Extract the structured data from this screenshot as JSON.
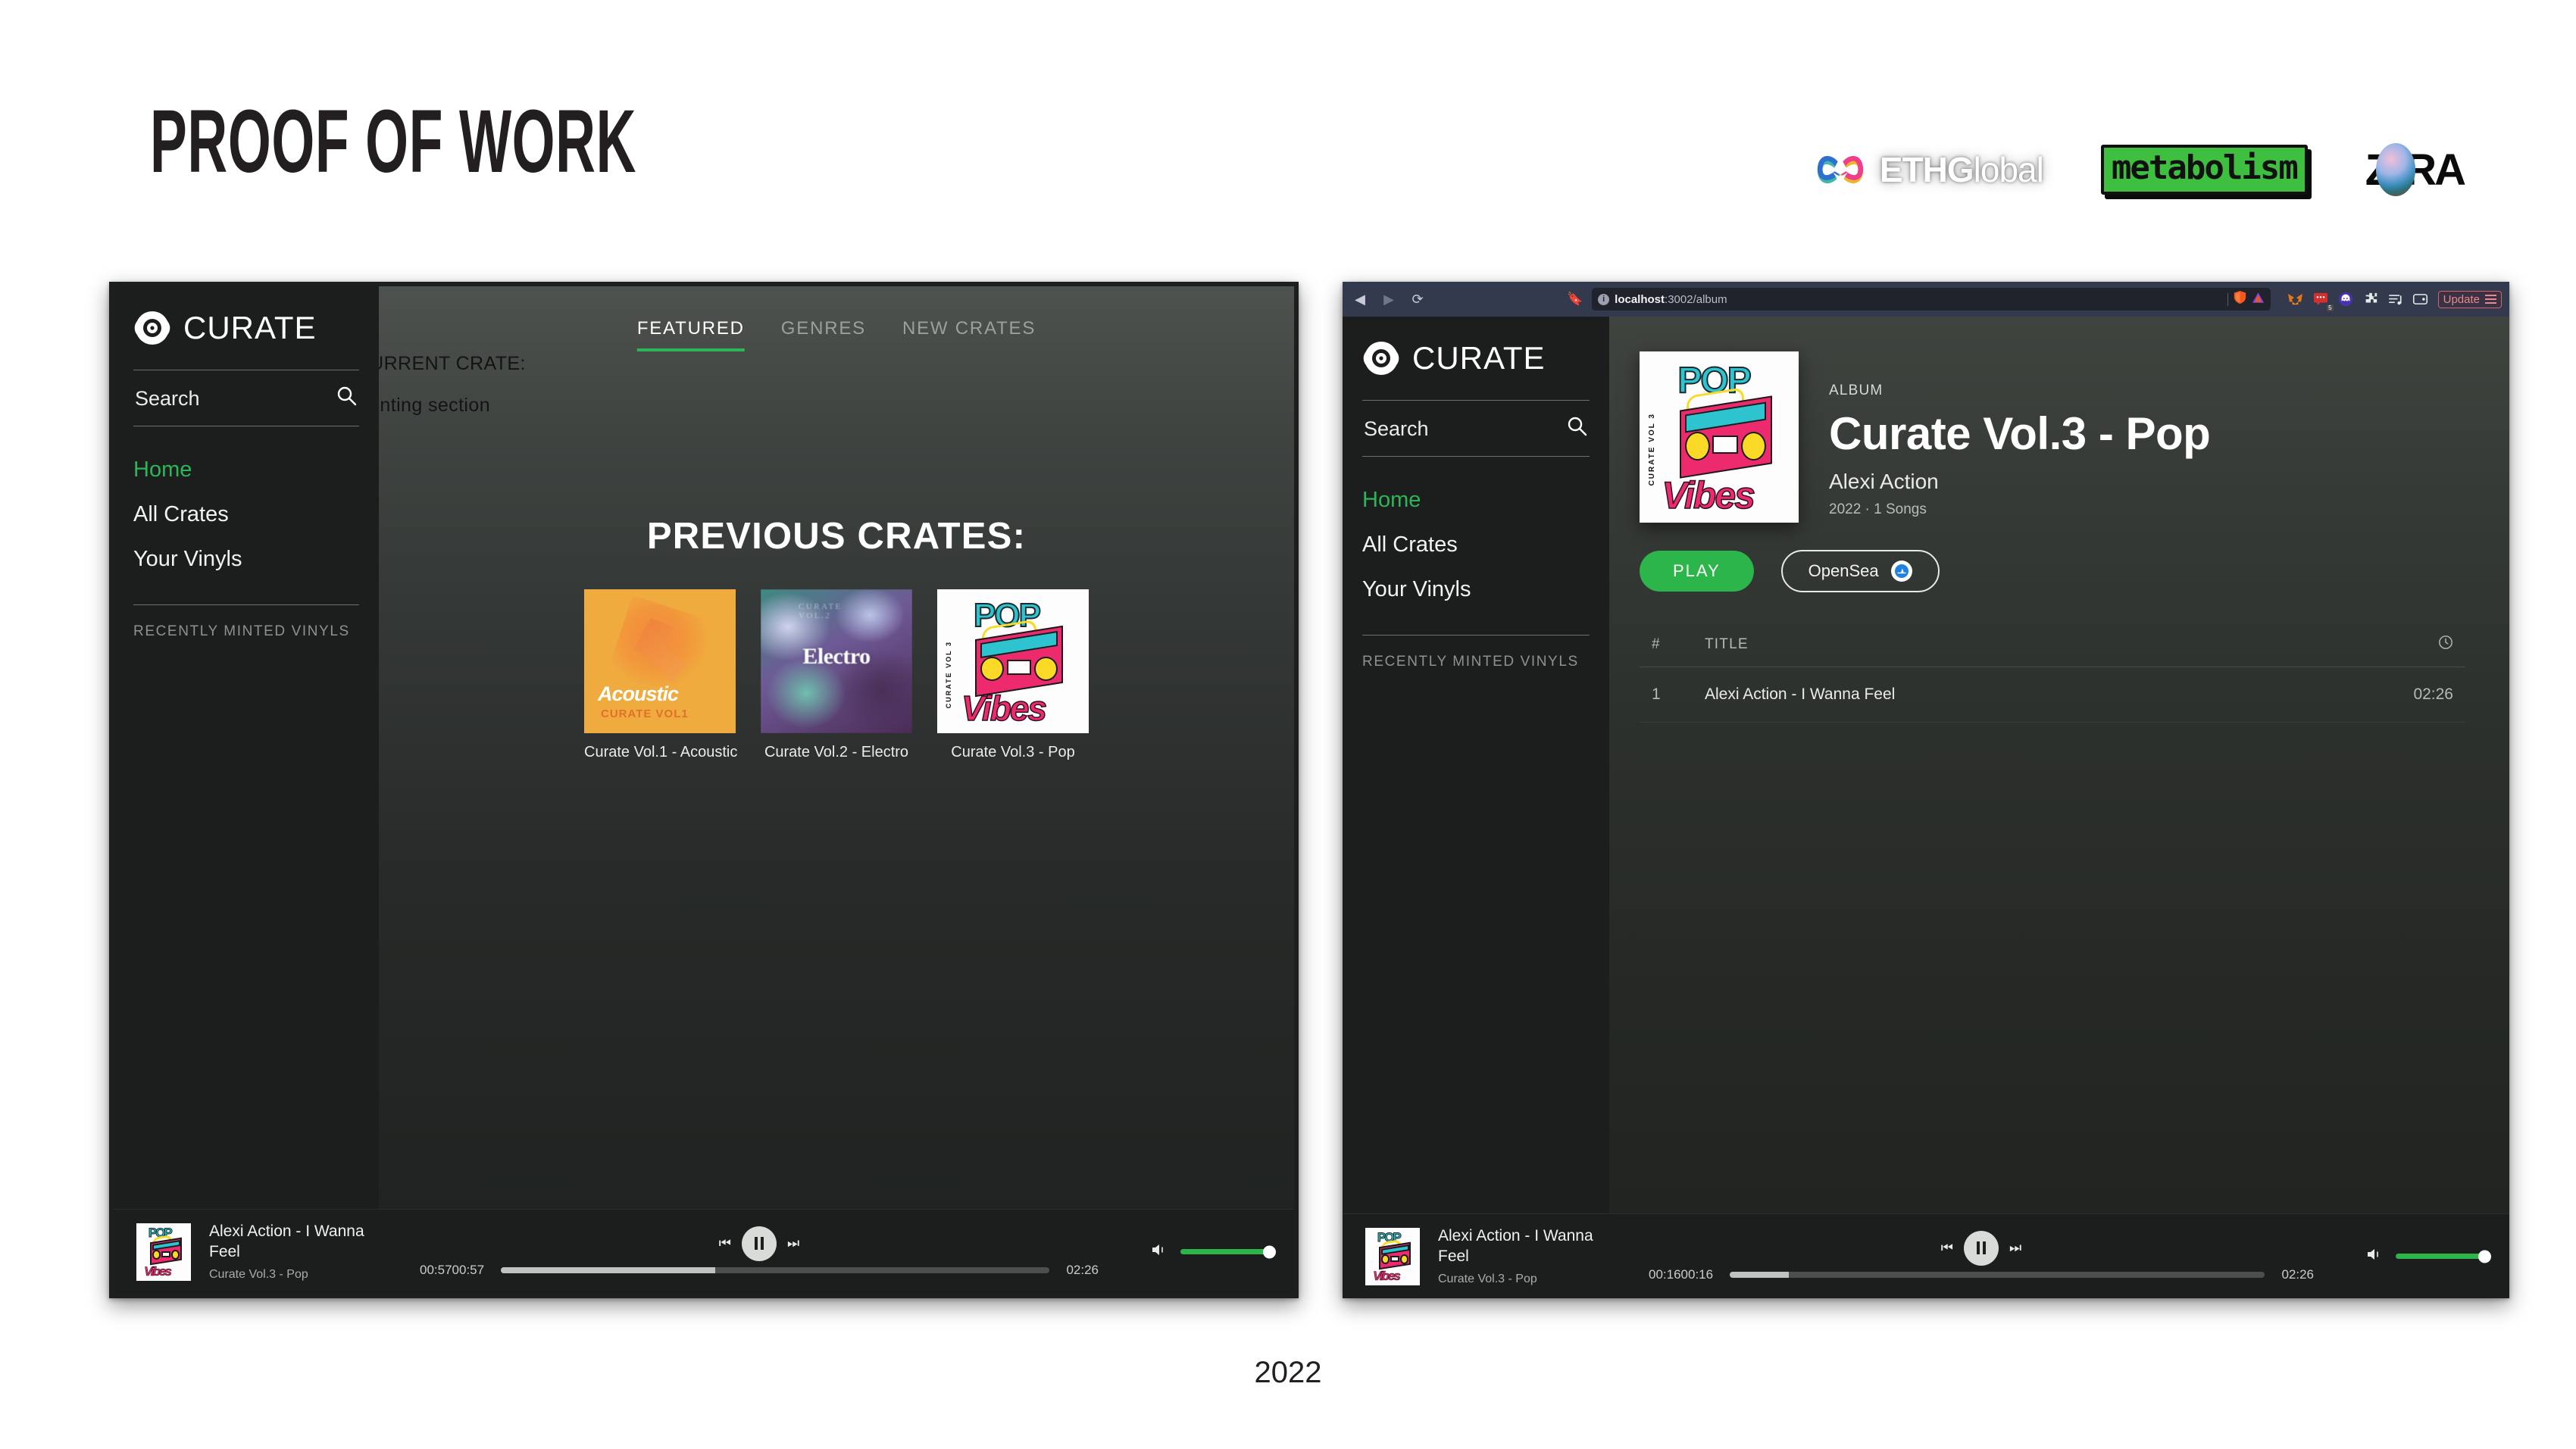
{
  "slide": {
    "title": "PROOF OF WORK",
    "caption": "2022",
    "logos": [
      {
        "name": "ETHGlobal",
        "part1": "ETHG",
        "part2": "lobal"
      },
      {
        "name": "metabolism",
        "text": "metabolism"
      },
      {
        "name": "ZORA",
        "left": "Z",
        "right": "RA"
      }
    ]
  },
  "sidebar": {
    "brand": "CURATE",
    "search_label": "Search",
    "items": [
      {
        "label": "Home",
        "active": true
      },
      {
        "label": "All Crates",
        "active": false
      },
      {
        "label": "Your Vinyls",
        "active": false
      }
    ],
    "section_caption": "RECENTLY MINTED VINYLS"
  },
  "left_window": {
    "tabs": [
      {
        "label": "FEATURED",
        "active": true
      },
      {
        "label": "GENRES",
        "active": false
      },
      {
        "label": "NEW CRATES",
        "active": false
      }
    ],
    "mint_heading": "MINT THE CURRENT CRATE:",
    "mint_note": "working on minting section",
    "previous_crates_heading": "PREVIOUS CRATES:",
    "crates": [
      {
        "label": "Curate Vol.1 - Acoustic",
        "art": "acoustic",
        "art_title": "Acoustic",
        "art_sub": "CURATE VOL1"
      },
      {
        "label": "Curate Vol.2 - Electro",
        "art": "electro",
        "art_title": "Electro",
        "art_sub": "CURATE VOL.2"
      },
      {
        "label": "Curate Vol.3 - Pop",
        "art": "pop",
        "art_title": "POP",
        "art_sub": "Vibes",
        "art_side": "CURATE VOL 3"
      }
    ],
    "player": {
      "track": "Alexi Action - I Wanna Feel",
      "album": "Curate Vol.3 - Pop",
      "elapsed": "00:5700:57",
      "duration": "02:26",
      "progress_percent": 39,
      "volume_percent": 100
    }
  },
  "right_window": {
    "browser": {
      "back_icon": "back-arrow-icon",
      "forward_icon": "forward-arrow-icon",
      "reload_icon": "reload-icon",
      "bookmark_icon": "bookmark-icon",
      "url_host": "localhost",
      "url_path": ":3002/album",
      "update_label": "Update",
      "extensions": [
        "metamask-fox-icon",
        "notification-badge-icon",
        "phantom-ghost-icon",
        "puzzle-piece-icon",
        "playlist-icon",
        "wallet-icon"
      ],
      "badge_count": "5"
    },
    "album": {
      "kicker": "ALBUM",
      "title": "Curate Vol.3 - Pop",
      "artist": "Alexi Action",
      "sub": "2022 · 1 Songs",
      "play_label": "PLAY",
      "opensea_label": "OpenSea"
    },
    "tracklist": {
      "headers": {
        "num": "#",
        "title": "TITLE",
        "duration_icon": "clock-icon"
      },
      "rows": [
        {
          "num": "1",
          "title": "Alexi Action - I Wanna Feel",
          "duration": "02:26"
        }
      ]
    },
    "player": {
      "track": "Alexi Action - I Wanna Feel",
      "album": "Curate Vol.3 - Pop",
      "elapsed": "00:1600:16",
      "duration": "02:26",
      "progress_percent": 11,
      "volume_percent": 100
    }
  },
  "colors": {
    "accent_green": "#2cb54a",
    "sidebar_bg": "#1b1e1c",
    "update_red": "#e38b8f"
  }
}
